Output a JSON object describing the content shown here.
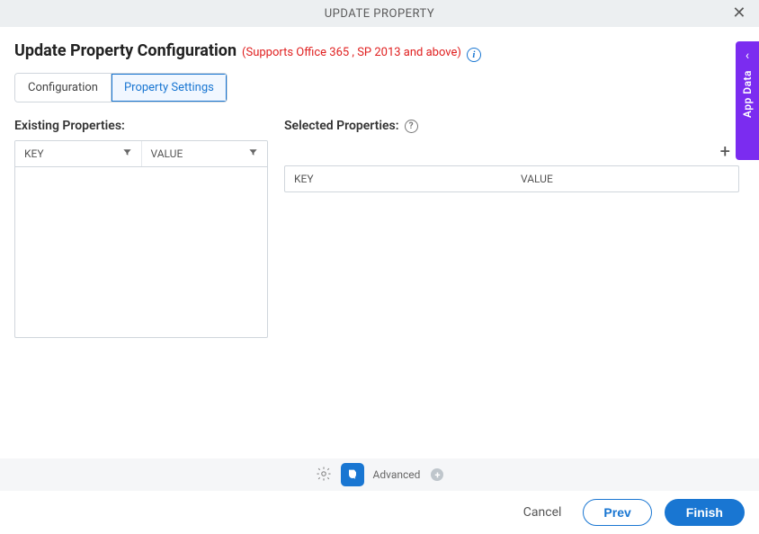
{
  "titlebar": {
    "title": "UPDATE PROPERTY"
  },
  "header": {
    "title": "Update Property Configuration",
    "support_note": "(Supports Office 365 , SP 2013 and above)"
  },
  "tabs": [
    {
      "label": "Configuration",
      "active": false
    },
    {
      "label": "Property Settings",
      "active": true
    }
  ],
  "existing": {
    "label": "Existing Properties:",
    "columns": [
      "KEY",
      "VALUE"
    ],
    "rows": []
  },
  "selected": {
    "label": "Selected Properties:",
    "columns": [
      "KEY",
      "VALUE"
    ],
    "rows": []
  },
  "bottom": {
    "advanced_label": "Advanced"
  },
  "footer": {
    "cancel": "Cancel",
    "prev": "Prev",
    "finish": "Finish"
  },
  "side_panel": {
    "label": "App Data"
  },
  "icons": {
    "info": "i",
    "help": "?",
    "plus": "+",
    "chevron_left": "‹"
  }
}
